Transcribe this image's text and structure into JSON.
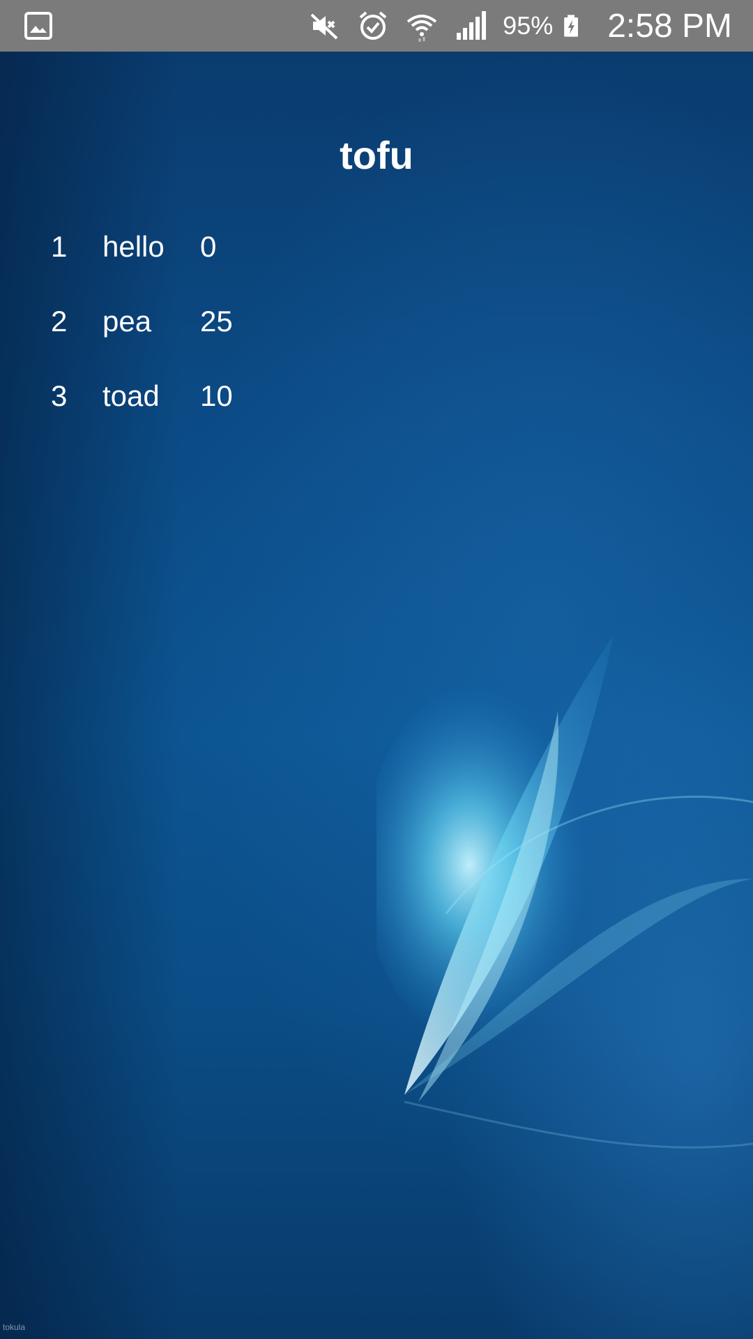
{
  "status_bar": {
    "battery_percent": "95%",
    "time": "2:58 PM",
    "icons": [
      "gallery-icon",
      "mute-icon",
      "alarm-icon",
      "wifi-icon",
      "signal-icon",
      "battery-charging-icon"
    ]
  },
  "app": {
    "title": "tofu",
    "rows": [
      {
        "rank": "1",
        "name": "hello",
        "score": "0"
      },
      {
        "rank": "2",
        "name": "pea",
        "score": "25"
      },
      {
        "rank": "3",
        "name": "toad",
        "score": "10"
      }
    ]
  },
  "wallpaper": {
    "watermark": "tokula"
  },
  "colors": {
    "status_bar": "#7b7b7b",
    "background": "#0c5592",
    "text": "#ffffff"
  }
}
